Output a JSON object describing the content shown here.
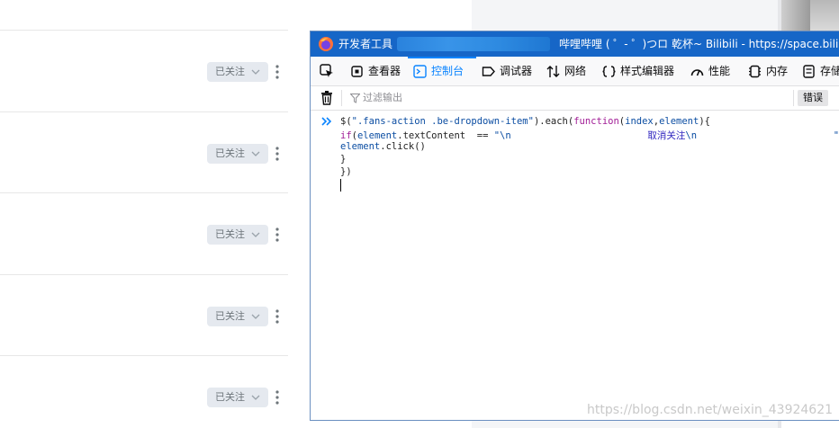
{
  "background": {
    "follow_buttons": [
      {
        "label": "已关注"
      },
      {
        "label": "已关注"
      },
      {
        "label": "已关注"
      },
      {
        "label": "已关注"
      },
      {
        "label": "已关注"
      }
    ]
  },
  "devtools": {
    "window_title": "开发者工具",
    "page_title": "哔哩哔哩 ( ゜- ゜)つロ 乾杯~ Bilibili - https://space.bilibi",
    "tabs": [
      {
        "label": "查看器",
        "icon": "inspector-icon"
      },
      {
        "label": "控制台",
        "icon": "console-icon",
        "active": true
      },
      {
        "label": "调试器",
        "icon": "debugger-icon"
      },
      {
        "label": "网络",
        "icon": "network-icon"
      },
      {
        "label": "样式编辑器",
        "icon": "style-editor-icon"
      },
      {
        "label": "性能",
        "icon": "performance-icon"
      },
      {
        "label": "内存",
        "icon": "memory-icon"
      },
      {
        "label": "存储",
        "icon": "storage-icon"
      }
    ],
    "filter_placeholder": "过滤输出",
    "filter_pills": [
      "错误"
    ],
    "console_lines": [
      [
        {
          "t": "$(",
          "c": "txt"
        },
        {
          "t": "\".fans-action .be-dropdown-item\"",
          "c": "str"
        },
        {
          "t": ").each(",
          "c": "txt"
        },
        {
          "t": "function",
          "c": "kw"
        },
        {
          "t": "(",
          "c": "txt"
        },
        {
          "t": "index",
          "c": "prop"
        },
        {
          "t": ",",
          "c": "txt"
        },
        {
          "t": "element",
          "c": "prop"
        },
        {
          "t": "){",
          "c": "txt"
        }
      ],
      [
        {
          "t": "if",
          "c": "kw"
        },
        {
          "t": "(",
          "c": "txt"
        },
        {
          "t": "element",
          "c": "prop"
        },
        {
          "t": ".textContent  == ",
          "c": "txt"
        },
        {
          "t": "\"\\n                        ",
          "c": "str"
        },
        {
          "t": "取消关注",
          "c": "chn"
        },
        {
          "t": "\\n                        \"",
          "c": "str"
        },
        {
          "t": "){",
          "c": "txt"
        }
      ],
      [
        {
          "t": "element",
          "c": "prop"
        },
        {
          "t": ".click()",
          "c": "txt"
        }
      ],
      [
        {
          "t": "}",
          "c": "txt"
        }
      ],
      [
        {
          "t": "})",
          "c": "txt"
        }
      ]
    ]
  },
  "watermark": "https://blog.csdn.net/weixin_43924621",
  "colors": {
    "accent": "#0a84ff",
    "titlebar": "#1666c7",
    "follow_bg": "#e5e9ef"
  }
}
